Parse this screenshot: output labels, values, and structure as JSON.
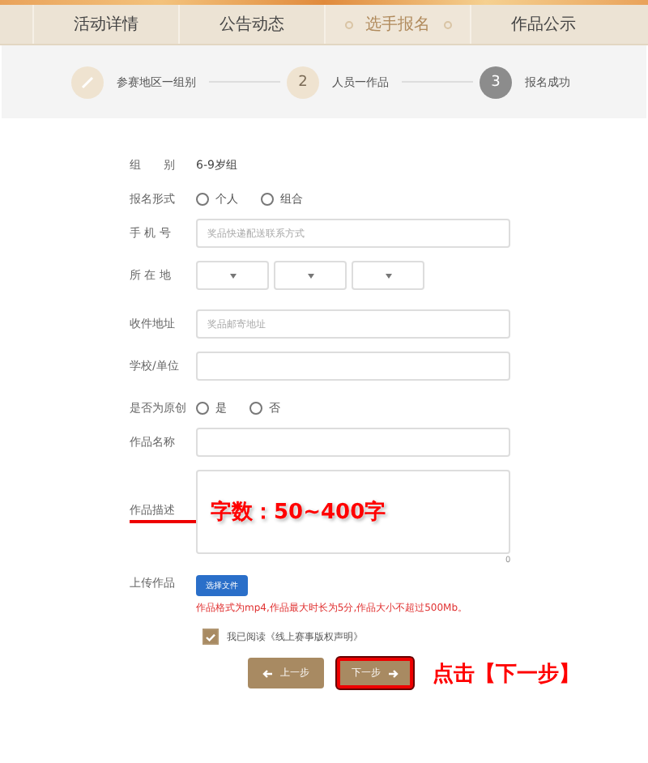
{
  "nav": {
    "tabs": [
      {
        "label": "活动详情",
        "selected": false
      },
      {
        "label": "公告动态",
        "selected": false
      },
      {
        "label": "选手报名",
        "selected": true
      },
      {
        "label": "作品公示",
        "selected": false
      }
    ]
  },
  "steps": [
    {
      "label": "参赛地区一组别",
      "current": false
    },
    {
      "number": "2",
      "label": "人员一作品",
      "current": false
    },
    {
      "number": "3",
      "label": "报名成功",
      "current": true
    }
  ],
  "form": [
    {
      "kind": "static",
      "label": "组　　别",
      "value": "6-9岁组"
    },
    {
      "kind": "radio",
      "label": "报名形式",
      "options": [
        {
          "label": "个人",
          "selected": false
        },
        {
          "label": "组合",
          "selected": false
        }
      ]
    },
    {
      "kind": "input",
      "label": "手 机 号",
      "placeholder": "奖品快递配送联系方式"
    },
    {
      "kind": "selects",
      "label": "所 在 地"
    },
    {
      "kind": "input",
      "label": "收件地址",
      "placeholder": "奖品邮寄地址"
    },
    {
      "kind": "input",
      "label": "学校/单位"
    },
    {
      "kind": "radio",
      "label": "是否为原创",
      "options": [
        {
          "label": "是",
          "selected": false
        },
        {
          "label": "否",
          "selected": false
        }
      ]
    },
    {
      "kind": "input",
      "label": "作品名称"
    },
    {
      "kind": "textarea",
      "label": "作品描述",
      "underlined": true,
      "annotation": "字数：50~400字",
      "counter": "0"
    },
    {
      "kind": "upload",
      "label": "上传作品",
      "button": "选择文件",
      "note": "作品格式为mp4,作品最大时长为5分,作品大小不超过500Mb。"
    }
  ],
  "agreement": {
    "label": "我已阅读《线上赛事版权声明》",
    "checked": true
  },
  "buttons": [
    {
      "label": "上一步",
      "kind": "prev",
      "highlighted": false
    },
    {
      "label": "下一步",
      "kind": "next",
      "highlighted": true
    }
  ],
  "annotation": "点击【下一步】"
}
